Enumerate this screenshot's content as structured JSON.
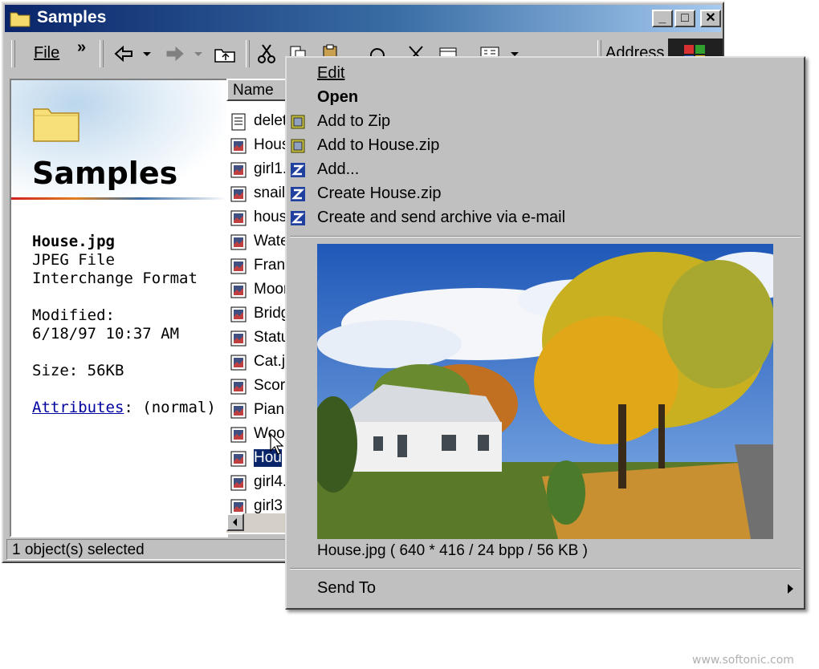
{
  "window": {
    "title": "Samples",
    "controls": {
      "minimize": "_",
      "maximize": "□",
      "close": "✕"
    }
  },
  "toolbar": {
    "file_menu": "File",
    "chevron": "»",
    "address_label": "Address"
  },
  "info_pane": {
    "folder_name": "Samples",
    "file_name": "House.jpg",
    "file_type_line1": "JPEG File",
    "file_type_line2": "Interchange Format",
    "modified_label": "Modified:",
    "modified_value": "6/18/97 10:37 AM",
    "size": "Size: 56KB",
    "attributes_link": "Attributes",
    "attributes_value": ": (normal)"
  },
  "file_list": {
    "column_name": "Name",
    "items": [
      {
        "name": "delet",
        "icon": "text-file-icon"
      },
      {
        "name": "Hous",
        "icon": "image-file-icon"
      },
      {
        "name": "girl1.",
        "icon": "image-file-icon"
      },
      {
        "name": "snail",
        "icon": "image-file-icon"
      },
      {
        "name": "hous",
        "icon": "image-file-icon"
      },
      {
        "name": "Wate",
        "icon": "image-file-icon"
      },
      {
        "name": "Franc",
        "icon": "image-file-icon"
      },
      {
        "name": "Moor",
        "icon": "image-file-icon"
      },
      {
        "name": "Bridg",
        "icon": "image-file-icon"
      },
      {
        "name": "Statu",
        "icon": "image-file-icon"
      },
      {
        "name": "Cat.jp",
        "icon": "image-file-icon"
      },
      {
        "name": "Scor",
        "icon": "image-file-icon"
      },
      {
        "name": "Pian",
        "icon": "image-file-icon"
      },
      {
        "name": "Woo",
        "icon": "image-file-icon"
      },
      {
        "name": "Hou",
        "icon": "image-file-icon",
        "selected": true
      },
      {
        "name": "girl4.",
        "icon": "image-file-icon"
      },
      {
        "name": "girl3",
        "icon": "image-file-icon"
      }
    ]
  },
  "status": {
    "text": "1 object(s) selected"
  },
  "context_menu": {
    "items": [
      {
        "label": "Edit",
        "icon": ""
      },
      {
        "label": "Open",
        "icon": "",
        "bold": true
      },
      {
        "label": "Add to Zip",
        "icon": "zip-archive-icon"
      },
      {
        "label": "Add to House.zip",
        "icon": "zip-archive-icon"
      },
      {
        "label": "Add...",
        "icon": "winzip-z-icon"
      },
      {
        "label": "Create House.zip",
        "icon": "winzip-z-icon"
      },
      {
        "label": "Create and send archive via e-mail",
        "icon": "winzip-z-icon"
      }
    ],
    "preview_caption": "House.jpg ( 640 * 416 / 24 bpp / 56 KB )",
    "send_to": "Send To"
  },
  "watermark": "www.softonic.com",
  "colors": {
    "title_active": "#0a246a",
    "selection": "#0a246a",
    "face": "#c0c0c0"
  }
}
